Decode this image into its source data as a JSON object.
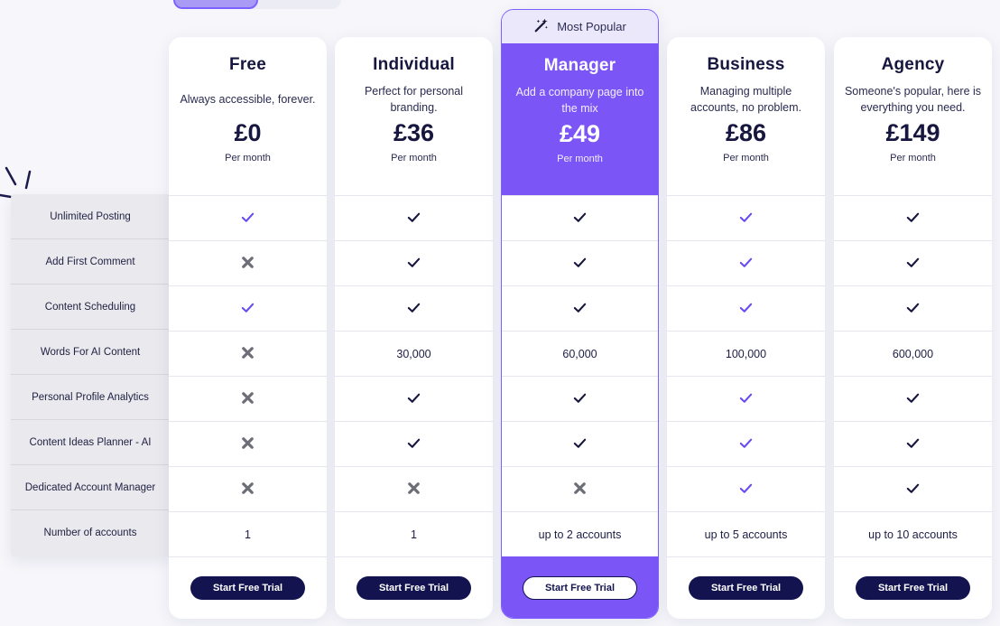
{
  "colors": {
    "accent": "#7b55f5",
    "navy": "#13144f",
    "check_dark": "#16163f",
    "check_purple": "#6a4cf0",
    "cross": "#6e6e78"
  },
  "popular_label": "Most Popular",
  "features": [
    "Unlimited Posting",
    "Add First Comment",
    "Content Scheduling",
    "Words For AI Content",
    "Personal Profile Analytics",
    "Content Ideas Planner - AI",
    "Dedicated Account Manager",
    "Number of accounts"
  ],
  "plans": [
    {
      "name": "Free",
      "description": "Always accessible, forever.",
      "price": "£0",
      "period": "Per month",
      "cta": "Start Free Trial",
      "values": [
        {
          "icon": "check-icon",
          "style": "purple"
        },
        {
          "icon": "cross-icon"
        },
        {
          "icon": "check-icon",
          "style": "purple"
        },
        {
          "icon": "cross-icon"
        },
        {
          "icon": "cross-icon"
        },
        {
          "icon": "cross-icon"
        },
        {
          "icon": "cross-icon"
        },
        {
          "text": "1"
        }
      ]
    },
    {
      "name": "Individual",
      "description": "Perfect for personal branding.",
      "price": "£36",
      "period": "Per month",
      "cta": "Start Free Trial",
      "values": [
        {
          "icon": "check-icon",
          "style": "dark"
        },
        {
          "icon": "check-icon",
          "style": "dark"
        },
        {
          "icon": "check-icon",
          "style": "dark"
        },
        {
          "text": "30,000"
        },
        {
          "icon": "check-icon",
          "style": "dark"
        },
        {
          "icon": "check-icon",
          "style": "dark"
        },
        {
          "icon": "cross-icon"
        },
        {
          "text": "1"
        }
      ]
    },
    {
      "name": "Manager",
      "description": "Add a company page into the mix",
      "price": "£49",
      "period": "Per month",
      "cta": "Start Free Trial",
      "featured": true,
      "values": [
        {
          "icon": "check-icon",
          "style": "dark"
        },
        {
          "icon": "check-icon",
          "style": "dark"
        },
        {
          "icon": "check-icon",
          "style": "dark"
        },
        {
          "text": "60,000"
        },
        {
          "icon": "check-icon",
          "style": "dark"
        },
        {
          "icon": "check-icon",
          "style": "dark"
        },
        {
          "icon": "cross-icon"
        },
        {
          "text": "up to 2 accounts"
        }
      ]
    },
    {
      "name": "Business",
      "description": "Managing multiple accounts, no problem.",
      "price": "£86",
      "period": "Per month",
      "cta": "Start Free Trial",
      "values": [
        {
          "icon": "check-icon",
          "style": "purple"
        },
        {
          "icon": "check-icon",
          "style": "purple"
        },
        {
          "icon": "check-icon",
          "style": "purple"
        },
        {
          "text": "100,000"
        },
        {
          "icon": "check-icon",
          "style": "purple"
        },
        {
          "icon": "check-icon",
          "style": "purple"
        },
        {
          "icon": "check-icon",
          "style": "purple"
        },
        {
          "text": "up to 5 accounts"
        }
      ]
    },
    {
      "name": "Agency",
      "description": "Someone's popular, here is everything you need.",
      "price": "£149",
      "period": "Per month",
      "cta": "Start Free Trial",
      "values": [
        {
          "icon": "check-icon",
          "style": "dark"
        },
        {
          "icon": "check-icon",
          "style": "dark"
        },
        {
          "icon": "check-icon",
          "style": "dark"
        },
        {
          "text": "600,000"
        },
        {
          "icon": "check-icon",
          "style": "dark"
        },
        {
          "icon": "check-icon",
          "style": "dark"
        },
        {
          "icon": "check-icon",
          "style": "dark"
        },
        {
          "text": "up to 10 accounts"
        }
      ]
    }
  ]
}
